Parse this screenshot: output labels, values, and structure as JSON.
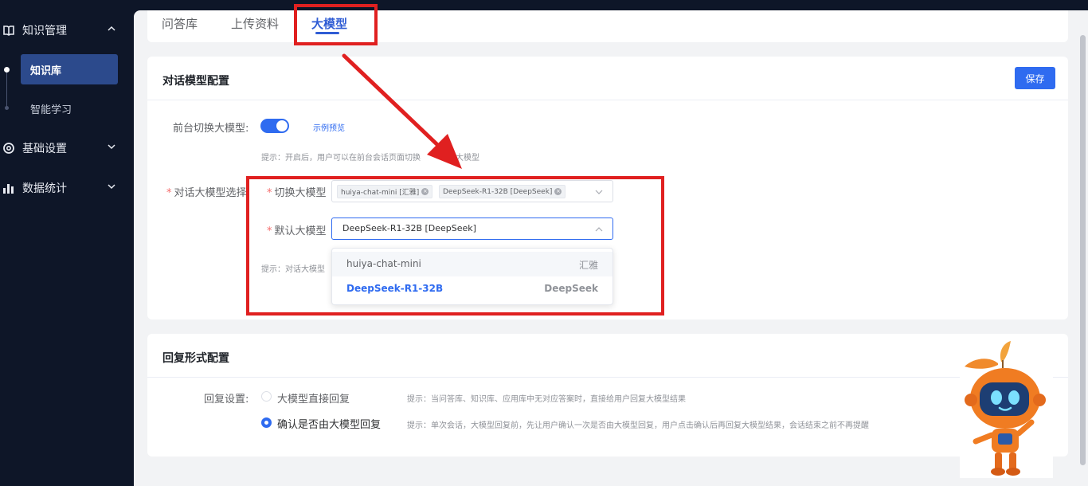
{
  "sidebar": {
    "groups": [
      {
        "label": "知识管理",
        "icon": "book-icon",
        "expanded": true
      },
      {
        "label": "基础设置",
        "icon": "settings-icon",
        "expanded": false
      },
      {
        "label": "数据统计",
        "icon": "bar-chart-icon",
        "expanded": false
      }
    ],
    "sub_items": [
      {
        "label": "知识库",
        "active": true
      },
      {
        "label": "智能学习",
        "active": false
      }
    ]
  },
  "tabs": [
    {
      "label": "问答库",
      "active": false
    },
    {
      "label": "上传资料",
      "active": false
    },
    {
      "label": "大模型",
      "active": true
    }
  ],
  "dialog_config": {
    "title": "对话模型配置",
    "save_label": "保存",
    "switch_label": "前台切换大模型:",
    "switch_on": true,
    "preview_link": "示例预览",
    "switch_hint": "提示：开启后，用户可以在前台会话页面切换",
    "switch_hint_tail": "大模型",
    "model_select_label": "对话大模型选择:",
    "switch_models_label": "切换大模型",
    "switch_models_tags": [
      "huiya-chat-mini [汇雅]",
      "DeepSeek-R1-32B [DeepSeek]"
    ],
    "default_model_label": "默认大模型",
    "default_model_value": "DeepSeek-R1-32B [DeepSeek]",
    "default_hint": "提示：对话大模型",
    "options": [
      {
        "name": "huiya-chat-mini",
        "provider": "汇雅",
        "selected": false
      },
      {
        "name": "DeepSeek-R1-32B",
        "provider": "DeepSeek",
        "selected": true
      }
    ]
  },
  "reply_config": {
    "title": "回复形式配置",
    "setting_label": "回复设置:",
    "options": [
      {
        "label": "大模型直接回复",
        "checked": false,
        "hint": "提示：当问答库、知识库、应用库中无对应答案时，直接给用户回复大模型结果"
      },
      {
        "label": "确认是否由大模型回复",
        "checked": true,
        "hint": "提示：单次会话，大模型回复前，先让用户确认一次是否由大模型回复，用户点击确认后再回复大模型结果，会话结束之前不再提醒"
      }
    ]
  },
  "colors": {
    "sidebar_bg": "#0e1628",
    "accent": "#2f6bf0",
    "annotation_red": "#e02020"
  }
}
